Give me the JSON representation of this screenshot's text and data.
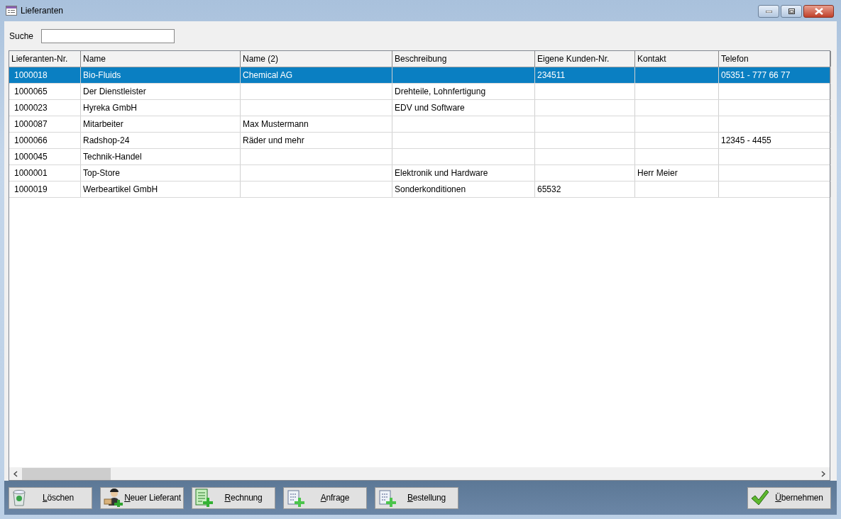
{
  "window": {
    "title": "Lieferanten"
  },
  "search": {
    "label": "Suche"
  },
  "table": {
    "columns": [
      "Lieferanten-Nr.",
      "Name",
      "Name (2)",
      "Beschreibung",
      "Eigene Kunden-Nr.",
      "Kontakt",
      "Telefon"
    ],
    "rows": [
      {
        "selected": true,
        "cells": [
          "1000018",
          "Bio-Fluids",
          "Chemical AG",
          "",
          "234511",
          "",
          "05351 - 777 66 77"
        ]
      },
      {
        "selected": false,
        "cells": [
          "1000065",
          "Der Dienstleister",
          "",
          "Drehteile, Lohnfertigung",
          "",
          "",
          ""
        ]
      },
      {
        "selected": false,
        "cells": [
          "1000023",
          "Hyreka GmbH",
          "",
          "EDV und Software",
          "",
          "",
          ""
        ]
      },
      {
        "selected": false,
        "cells": [
          "1000087",
          "Mitarbeiter",
          "Max Mustermann",
          "",
          "",
          "",
          ""
        ]
      },
      {
        "selected": false,
        "cells": [
          "1000066",
          "Radshop-24",
          "Räder und mehr",
          "",
          "",
          "",
          "12345 - 4455"
        ]
      },
      {
        "selected": false,
        "cells": [
          "1000045",
          "Technik-Handel",
          "",
          "",
          "",
          "",
          ""
        ]
      },
      {
        "selected": false,
        "cells": [
          "1000001",
          "Top-Store",
          "",
          "Elektronik und Hardware",
          "",
          "Herr Meier",
          ""
        ]
      },
      {
        "selected": false,
        "cells": [
          "1000019",
          "Werbeartikel GmbH",
          "",
          "Sonderkonditionen",
          "65532",
          "",
          ""
        ]
      }
    ]
  },
  "buttons": [
    {
      "kind": "trash",
      "label": "Löschen"
    },
    {
      "kind": "person",
      "label": "Neuer Lieferant"
    },
    {
      "kind": "invoice",
      "label": "Rechnung"
    },
    {
      "kind": "doc",
      "label": "Anfrage"
    },
    {
      "kind": "doc",
      "label": "Bestellung"
    }
  ],
  "confirm_button": {
    "label": "Übernehmen"
  }
}
